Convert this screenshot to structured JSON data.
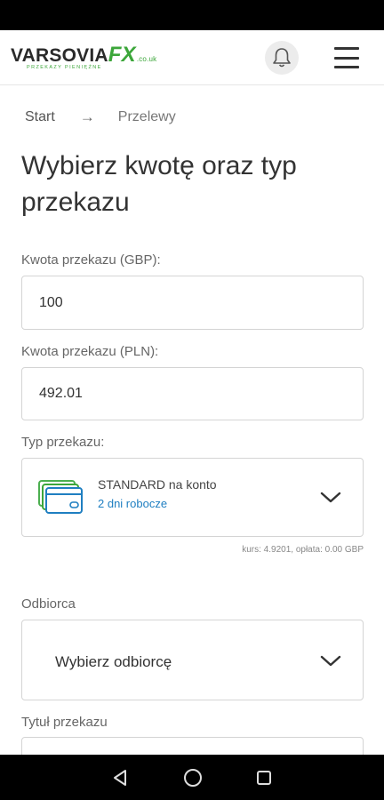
{
  "header": {
    "logo_main": "VARSOVIA",
    "logo_fx": "FX",
    "logo_domain": ".co.uk",
    "logo_tagline": "PRZEKAZY PIENIĘŻNE",
    "bell_icon": "bell-icon",
    "menu_icon": "hamburger-menu-icon"
  },
  "breadcrumb": {
    "home": "Start",
    "separator": "→",
    "current": "Przelewy"
  },
  "page_title": "Wybierz kwotę oraz typ przekazu",
  "form": {
    "amount_gbp_label": "Kwota przekazu (GBP):",
    "amount_gbp_value": "100",
    "amount_pln_label": "Kwota przekazu (PLN):",
    "amount_pln_value": "492.01",
    "transfer_type_label": "Typ przekazu:",
    "transfer_type_name": "STANDARD na konto",
    "transfer_type_time": "2 dni robocze",
    "rate_info": "kurs: 4.9201, opłata: 0.00 GBP",
    "recipient_label": "Odbiorca",
    "recipient_placeholder": "Wybierz odbiorcę",
    "title_label": "Tytuł przekazu"
  },
  "colors": {
    "brand_green": "#3ca63a",
    "link_blue": "#1f7fc1"
  },
  "nav": {
    "back_icon": "back-triangle-icon",
    "home_icon": "home-circle-icon",
    "recents_icon": "recents-square-icon"
  }
}
